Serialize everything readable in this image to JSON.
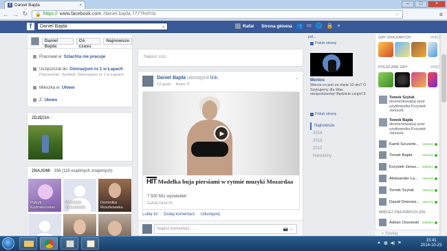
{
  "browser": {
    "tab_title": "Daniel Bajda",
    "url_scheme": "https://",
    "url_host": "www.facebook.com",
    "url_path": "/daniel.bajda.777?fref=ts"
  },
  "fb_header": {
    "search_value": "Daniel Bajda",
    "user_name": "Rafał",
    "home_label": "Strona główna"
  },
  "timeline_bar": {
    "name": "Daniel Bajda",
    "btn1": "Oś czasu",
    "btn2": "Najnowsze"
  },
  "intro": {
    "work_prefix": "Pracował w:",
    "work_place": "Szlachta nie pracuje",
    "school_prefix": "Uczęszczał do:",
    "school_place": "Gimnazjum nr 1 w Łapach",
    "school_previous": "Poprzednie: Spotted: Gimnazjum nr 1 w Łapach",
    "lives_prefix": "Mieszka w:",
    "lives_place": "Ułowo",
    "from_prefix": "Z:",
    "from_place": "Ułowo"
  },
  "photos": {
    "header": "ZDJĘCIA",
    "dot": "·"
  },
  "friends": {
    "header": "ZNAJOMI",
    "count": "· 336 (116 wspólnych znajomych)",
    "items": [
      {
        "name": "Patryk Kuźmierowski"
      },
      {
        "name": "Przemek Zakrzewski"
      },
      {
        "name": "Dominika Roszkowska"
      }
    ]
  },
  "composer": {
    "placeholder": "Napisz coś..."
  },
  "post": {
    "author": "Daniel Bajda",
    "action": "udostępnił",
    "object": "link.",
    "time": "19 godz.",
    "source": "Iliews",
    "link_brand": "HIT",
    "link_title": "Modelka buja piersiami w rytmie muzyki Mozardaa",
    "views": "7 500 591 wyświetleń",
    "domain": "IGAZETA24.PL",
    "actions": [
      "Lubię to!",
      "Dodaj komentarz",
      "Udostępnij"
    ],
    "comment_placeholder": "Napisz komentarz..."
  },
  "right_col": {
    "top_text": "pol...",
    "like1": "Polub stronę",
    "ad_title": "Mentos",
    "ad_desc": "Wiecie co jest za rówie 10 dni?  O Szykujemy dla Was niespodziankę! Będzicie czujni! 3",
    "like2": "Polub stronę",
    "years": [
      "Najnowsze",
      "2014",
      "2013",
      "2012",
      "Narodziny"
    ]
  },
  "games": {
    "friends_games": "GRY ZNAJOMYCH",
    "more1": "WIĘCEJ",
    "recommended": "POLECANE GRY",
    "more2": "WIĘCEJ"
  },
  "chat": {
    "feed": [
      {
        "name": "Tomek Szyluk",
        "text": "skomentował(a) post użytkownika Krzysiek Januszk."
      },
      {
        "name": "Tomek Bajda",
        "text": "skomentował(a) post użytkownika Krzysiek Januszk."
      }
    ],
    "contacts": [
      {
        "name": "Kamil Szczerbi...",
        "status": "Internet"
      },
      {
        "name": "Tomek Bajda",
        "status": "Internet"
      },
      {
        "name": "Krzysiek Janus...",
        "status": "Mobilne"
      },
      {
        "name": "Aleksander La...",
        "status": "Internet"
      },
      {
        "name": "Tomek Szyluk",
        "status": "Internet"
      },
      {
        "name": "Dawid Dzienisz...",
        "status": "Internet"
      }
    ],
    "more_contacts": "WIĘCEJ ZNAJOMYCH (25)",
    "extra_contact": "Adrian Ossowski",
    "extra_status": "Mobilne",
    "search_placeholder": "Szukaj"
  },
  "taskbar": {
    "time": "15:41",
    "date": "2014-10-23"
  }
}
